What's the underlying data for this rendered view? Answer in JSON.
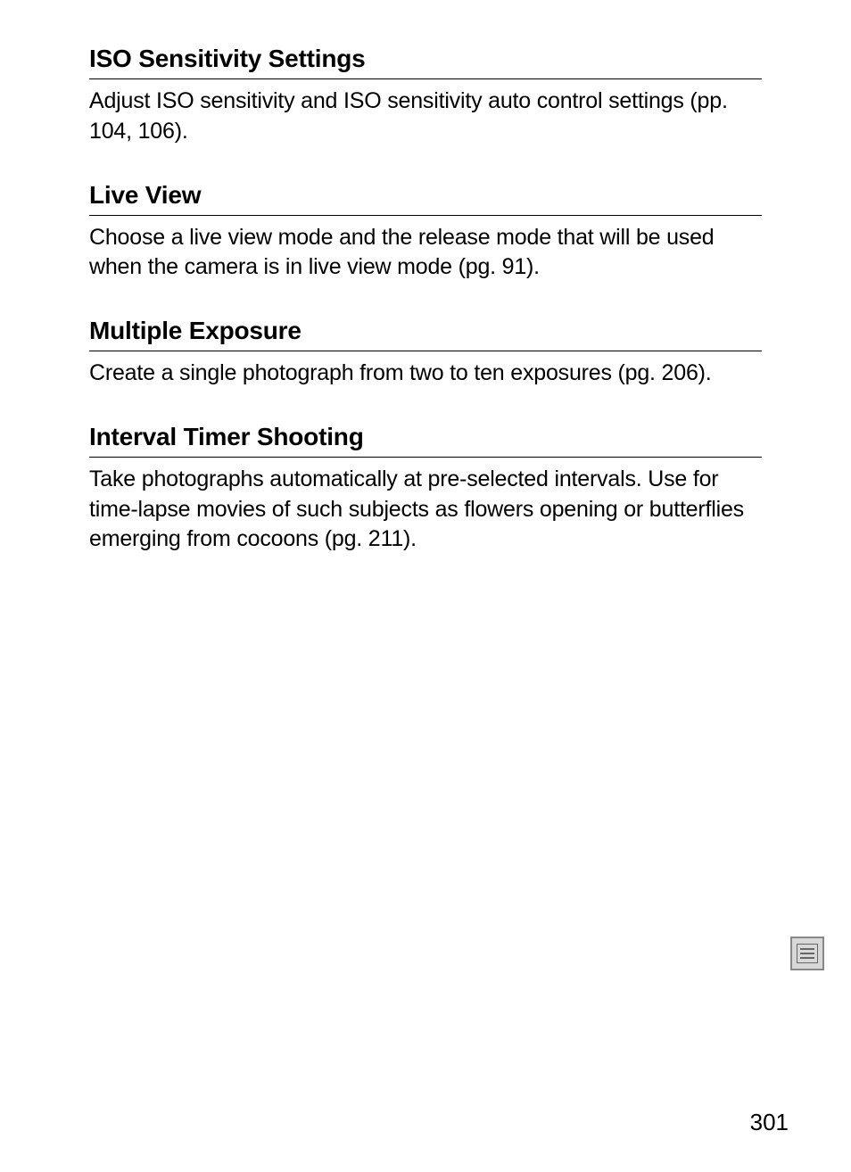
{
  "sections": [
    {
      "heading": "ISO Sensitivity Settings",
      "body": "Adjust ISO sensitivity and ISO sensitivity auto control settings (pp. 104, 106)."
    },
    {
      "heading": "Live View",
      "body": "Choose a live view mode and the release mode that will be used when the camera is in live view mode (pg. 91)."
    },
    {
      "heading": "Multiple Exposure",
      "body": "Create a single photograph from two to ten exposures (pg. 206)."
    },
    {
      "heading": "Interval Timer Shooting",
      "body": "Take photographs automatically at pre-selected intervals.  Use for time-lapse movies of such subjects as flowers opening or butterflies emerging from cocoons (pg. 211)."
    }
  ],
  "page_number": "301"
}
